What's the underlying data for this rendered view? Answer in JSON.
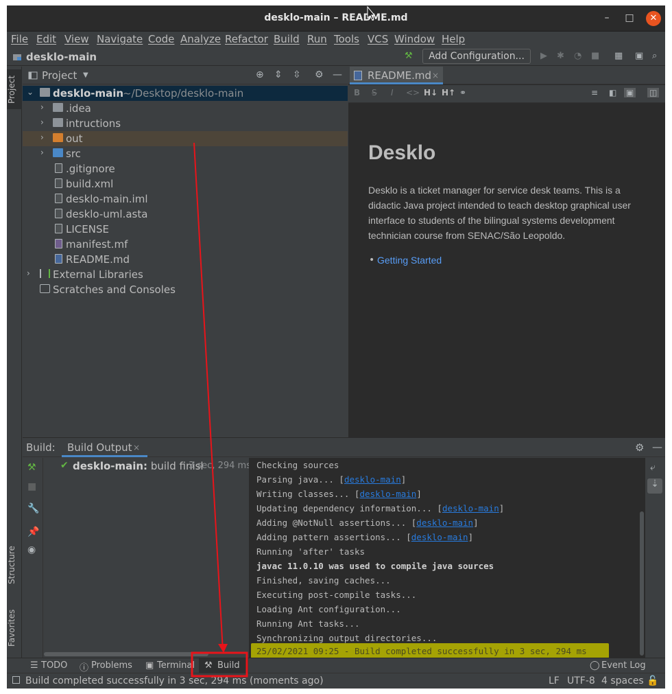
{
  "window": {
    "title": "desklo-main – README.md",
    "minimize": "–",
    "maximize": "□",
    "close": "✕"
  },
  "menu": [
    "File",
    "Edit",
    "View",
    "Navigate",
    "Code",
    "Analyze",
    "Refactor",
    "Build",
    "Run",
    "Tools",
    "VCS",
    "Window",
    "Help"
  ],
  "navbar": {
    "project": "desklo-main",
    "add_configuration": "Add Configuration..."
  },
  "left_strip": {
    "project": "Project",
    "structure": "Structure",
    "favorites": "Favorites"
  },
  "project_panel": {
    "title": "Project",
    "tree": [
      {
        "label": "desklo-main",
        "path": "~/Desktop/desklo-main",
        "type": "module",
        "expanded": true
      },
      {
        "label": ".idea",
        "type": "folder"
      },
      {
        "label": "intructions",
        "type": "folder"
      },
      {
        "label": "out",
        "type": "folder-excluded"
      },
      {
        "label": "src",
        "type": "folder-source"
      },
      {
        "label": ".gitignore",
        "type": "file"
      },
      {
        "label": "build.xml",
        "type": "file"
      },
      {
        "label": "desklo-main.iml",
        "type": "file"
      },
      {
        "label": "desklo-uml.asta",
        "type": "file"
      },
      {
        "label": "LICENSE",
        "type": "file"
      },
      {
        "label": "manifest.mf",
        "type": "file"
      },
      {
        "label": "README.md",
        "type": "file"
      },
      {
        "label": "External Libraries",
        "type": "libraries"
      },
      {
        "label": "Scratches and Consoles",
        "type": "scratches"
      }
    ]
  },
  "editor": {
    "tab": "README.md",
    "markdown_toolbar": [
      "B",
      "S",
      "I",
      "<>",
      "H↓",
      "H↑",
      "link"
    ],
    "preview": {
      "heading": "Desklo",
      "paragraph": "Desklo is a ticket manager for service desk teams. This is a didactic Java project intended to teach desktop graphical user interface to students of the bilingual systems development technician course from SENAC/São Leopoldo.",
      "link": "Getting Started"
    }
  },
  "build_panel": {
    "label": "Build:",
    "tab": "Build Output",
    "status_project": "desklo-main:",
    "status_text": "build finisl",
    "status_time": "3 sec, 294 ms",
    "console": [
      {
        "text": "Checking sources"
      },
      {
        "text": "Parsing java... [",
        "link": "desklo-main",
        "suffix": "]"
      },
      {
        "text": "Writing classes... [",
        "link": "desklo-main",
        "suffix": "]"
      },
      {
        "text": "Updating dependency information... [",
        "link": "desklo-main",
        "suffix": "]"
      },
      {
        "text": "Adding @NotNull assertions... [",
        "link": "desklo-main",
        "suffix": "]"
      },
      {
        "text": "Adding pattern assertions... [",
        "link": "desklo-main",
        "suffix": "]"
      },
      {
        "text": "Running 'after' tasks"
      },
      {
        "text": "javac 11.0.10 was used to compile java sources",
        "bold": true
      },
      {
        "text": "Finished, saving caches..."
      },
      {
        "text": "Executing post-compile tasks..."
      },
      {
        "text": "Loading Ant configuration..."
      },
      {
        "text": "Running Ant tasks..."
      },
      {
        "text": "Synchronizing output directories..."
      },
      {
        "text": "25/02/2021 09:25 - Build completed successfully in 3 sec, 294 ms",
        "highlight": true
      }
    ]
  },
  "bottom_tabs": {
    "todo": "TODO",
    "problems": "Problems",
    "terminal": "Terminal",
    "build": "Build",
    "event_log": "Event Log"
  },
  "status_bar": {
    "message": "Build completed successfully in 3 sec, 294 ms (moments ago)",
    "line_sep": "LF",
    "encoding": "UTF-8",
    "indent": "4 spaces"
  },
  "colors": {
    "accent": "#4a88c7",
    "annotation": "#e8141a",
    "highlight": "#b2b000",
    "link": "#287bde"
  }
}
